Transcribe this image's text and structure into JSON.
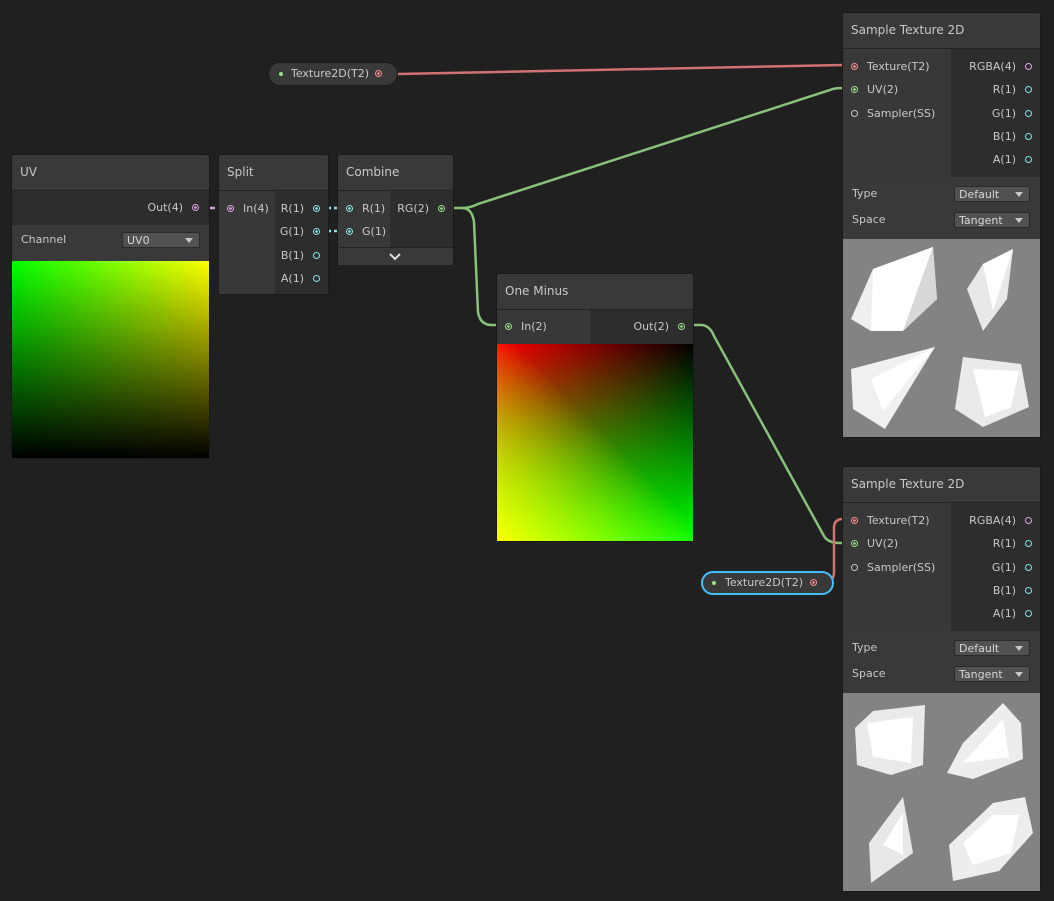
{
  "colors": {
    "background": "#202020",
    "node": "#393939",
    "wire_texture": "#d07272",
    "wire_uv": "#87c17a",
    "wire_float": "#84e4e7",
    "wire_vec4": "#e0a4e6",
    "selection": "#44c0ff"
  },
  "property_nodes": [
    {
      "label": "Texture2D(T2)",
      "selected": false
    },
    {
      "label": "Texture2D(T2)",
      "selected": true
    }
  ],
  "uv_node": {
    "title": "UV",
    "output": "Out(4)",
    "channel_label": "Channel",
    "channel_value": "UV0"
  },
  "split_node": {
    "title": "Split",
    "input": "In(4)",
    "outputs": [
      "R(1)",
      "G(1)",
      "B(1)",
      "A(1)"
    ]
  },
  "combine_node": {
    "title": "Combine",
    "inputs": [
      "R(1)",
      "G(1)"
    ],
    "output": "RG(2)",
    "expand_icon": "chevron-down-icon"
  },
  "one_minus_node": {
    "title": "One Minus",
    "input": "In(2)",
    "output": "Out(2)"
  },
  "sample_texture_nodes": [
    {
      "title": "Sample Texture 2D",
      "inputs": [
        "Texture(T2)",
        "UV(2)",
        "Sampler(SS)"
      ],
      "outputs": [
        "RGBA(4)",
        "R(1)",
        "G(1)",
        "B(1)",
        "A(1)"
      ],
      "type_label": "Type",
      "type_value": "Default",
      "space_label": "Space",
      "space_value": "Tangent"
    },
    {
      "title": "Sample Texture 2D",
      "inputs": [
        "Texture(T2)",
        "UV(2)",
        "Sampler(SS)"
      ],
      "outputs": [
        "RGBA(4)",
        "R(1)",
        "G(1)",
        "B(1)",
        "A(1)"
      ],
      "type_label": "Type",
      "type_value": "Default",
      "space_label": "Space",
      "space_value": "Tangent"
    }
  ]
}
